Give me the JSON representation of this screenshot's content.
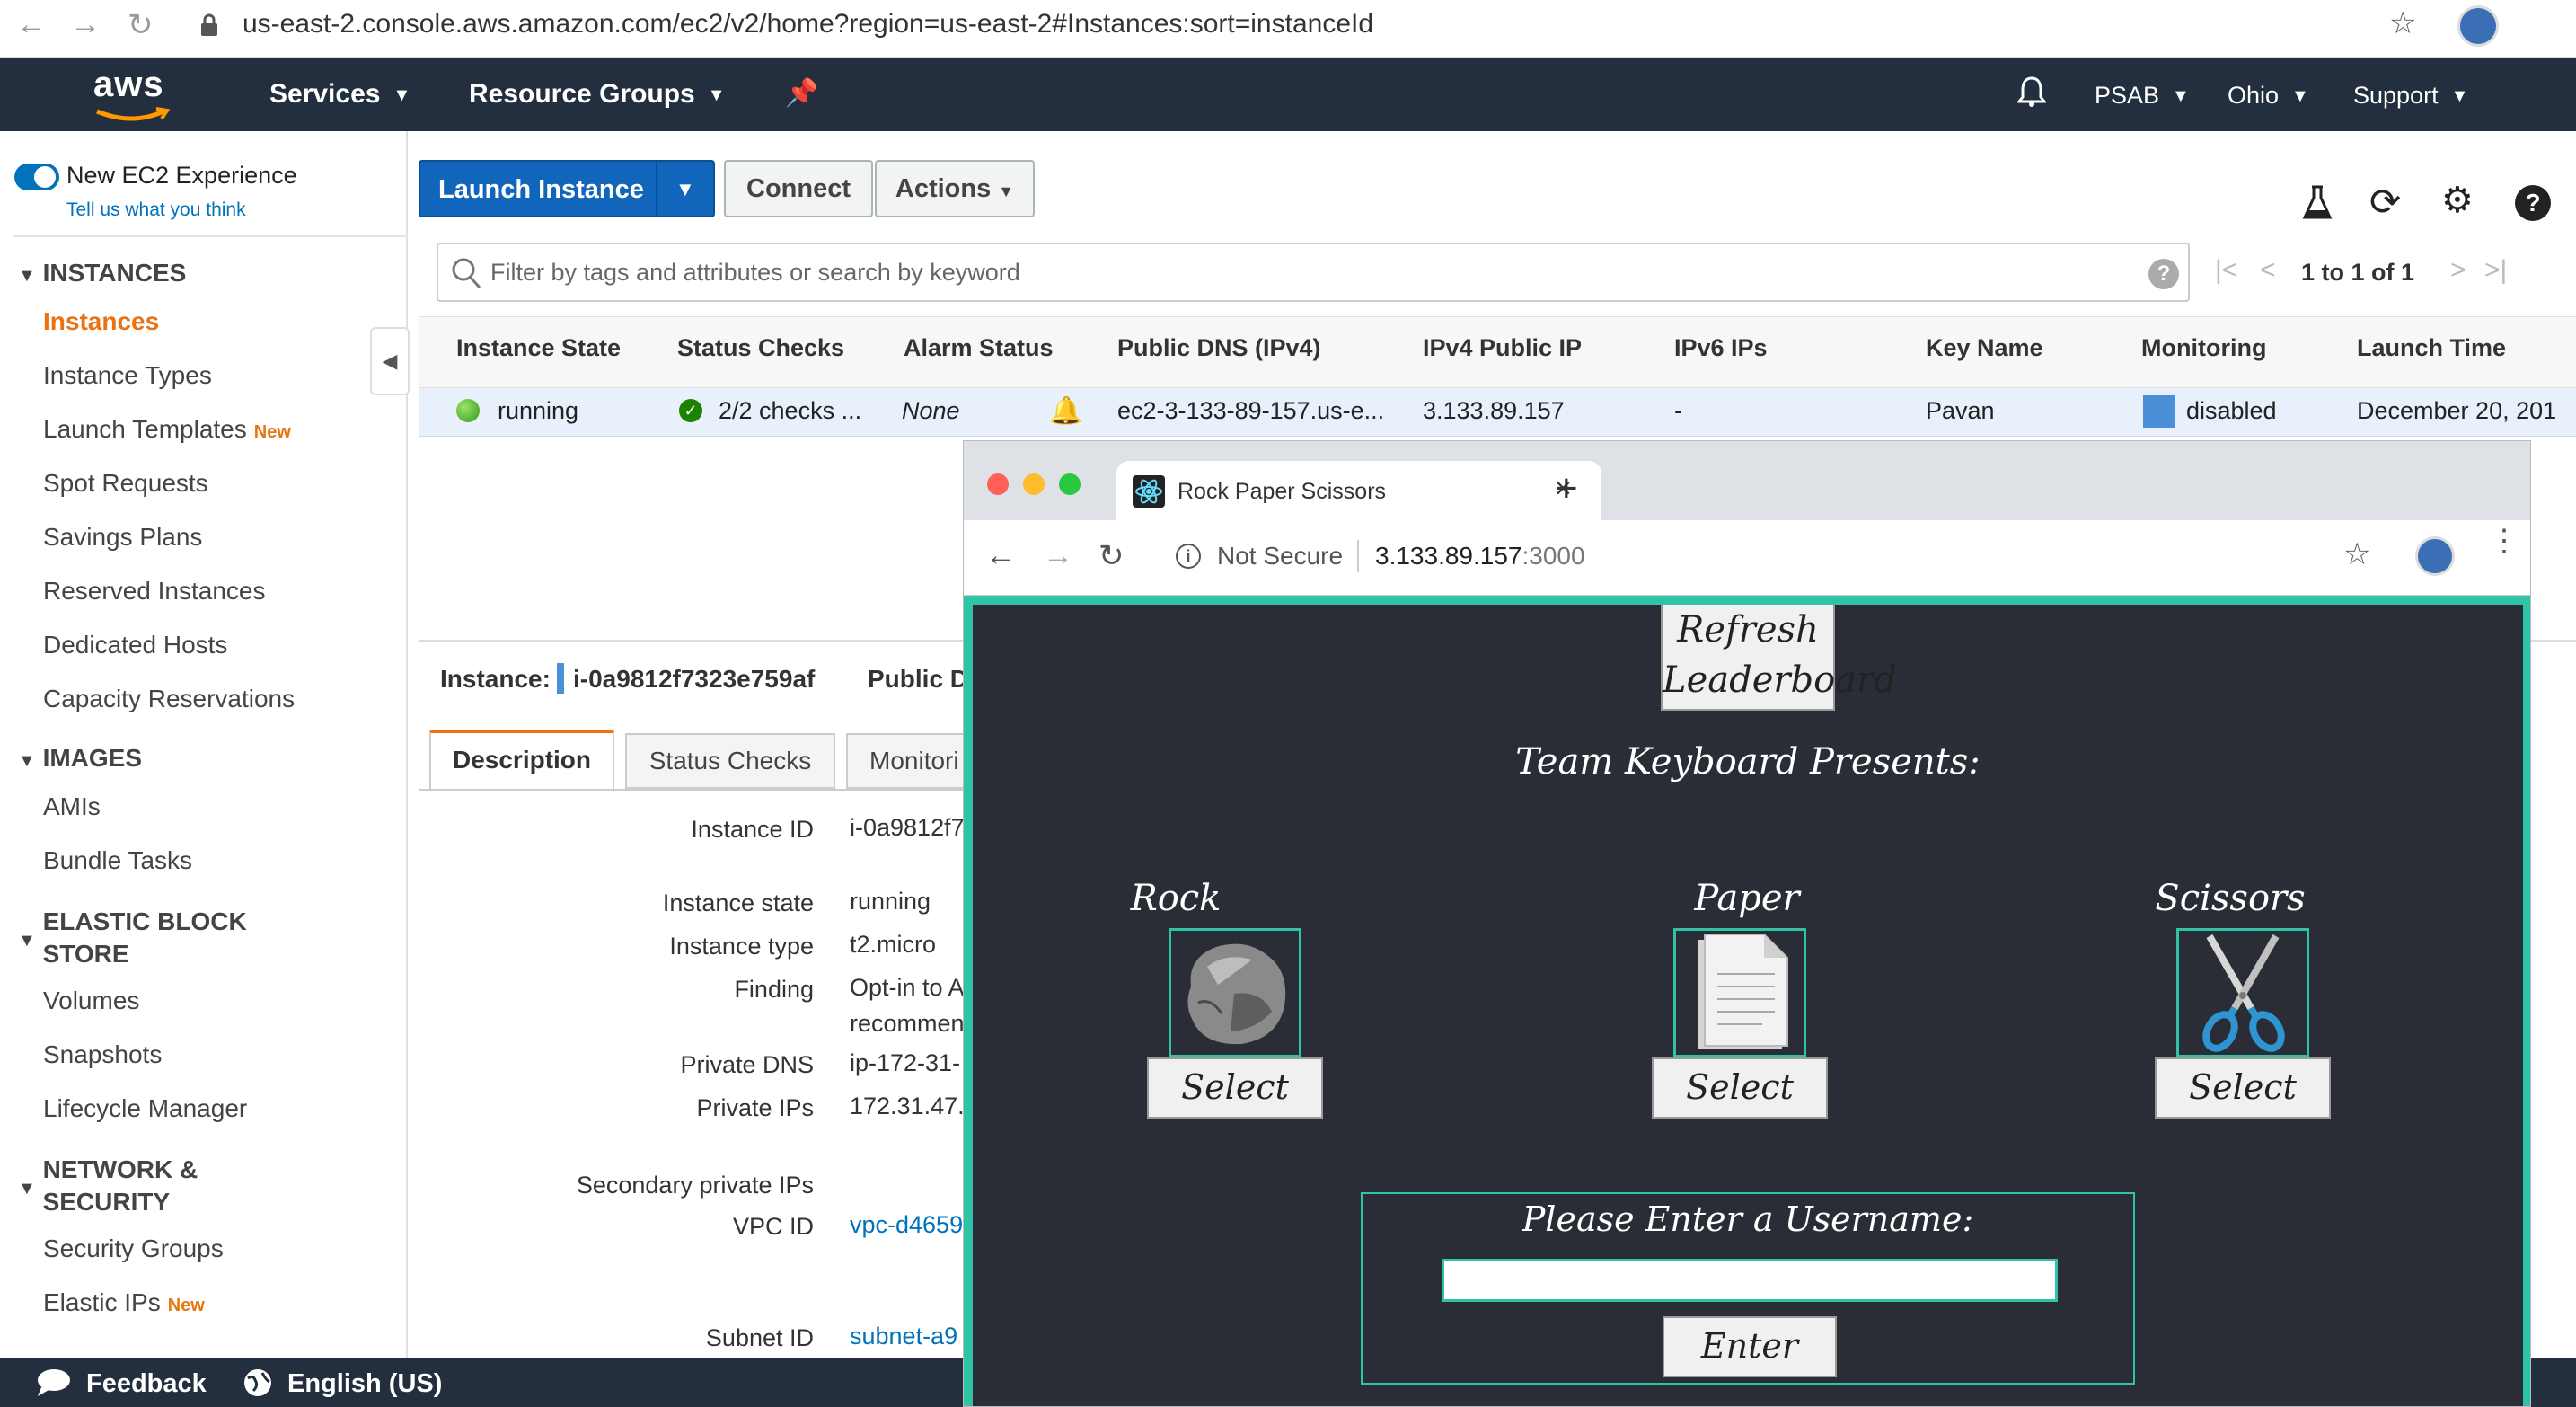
{
  "browser": {
    "url": "us-east-2.console.aws.amazon.com/ec2/v2/home?region=us-east-2#Instances:sort=instanceId"
  },
  "aws_nav": {
    "logo": "aws",
    "services": "Services",
    "resource_groups": "Resource Groups",
    "account": "PSAB",
    "region": "Ohio",
    "support": "Support"
  },
  "sidebar": {
    "toggle_label": "New EC2 Experience",
    "feedback_link": "Tell us what you think",
    "new_tag": "New",
    "sections": [
      {
        "title": "INSTANCES",
        "items": [
          "Instances",
          "Instance Types",
          "Launch Templates",
          "Spot Requests",
          "Savings Plans",
          "Reserved Instances",
          "Dedicated Hosts",
          "Capacity Reservations"
        ]
      },
      {
        "title": "IMAGES",
        "items": [
          "AMIs",
          "Bundle Tasks"
        ]
      },
      {
        "title_line1": "ELASTIC BLOCK",
        "title_line2": "STORE",
        "items": [
          "Volumes",
          "Snapshots",
          "Lifecycle Manager"
        ]
      },
      {
        "title_line1": "NETWORK &",
        "title_line2": "SECURITY",
        "items": [
          "Security Groups",
          "Elastic IPs"
        ]
      }
    ]
  },
  "toolbar": {
    "launch": "Launch Instance",
    "connect": "Connect",
    "actions": "Actions"
  },
  "filter": {
    "placeholder": "Filter by tags and attributes or search by keyword",
    "pagination": "1 to 1 of 1"
  },
  "table": {
    "headers": [
      "Instance State",
      "Status Checks",
      "Alarm Status",
      "Public DNS (IPv4)",
      "IPv4 Public IP",
      "IPv6 IPs",
      "Key Name",
      "Monitoring",
      "Launch Time"
    ],
    "row": {
      "state": "running",
      "checks": "2/2 checks ...",
      "alarm": "None",
      "dns": "ec2-3-133-89-157.us-e...",
      "ip": "3.133.89.157",
      "ipv6": "-",
      "key": "Pavan",
      "monitoring": "disabled",
      "launch": "December 20, 201"
    }
  },
  "details": {
    "instance_label": "Instance:",
    "instance_id": "i-0a9812f7323e759af",
    "public_label": "Public D",
    "tabs": [
      "Description",
      "Status Checks",
      "Monitori"
    ],
    "fields": [
      {
        "label": "Instance ID",
        "value": "i-0a9812f7"
      },
      {
        "label": "Instance state",
        "value": "running"
      },
      {
        "label": "Instance type",
        "value": "t2.micro"
      },
      {
        "label": "Finding",
        "value": "Opt-in to A"
      },
      {
        "label": "",
        "value": "recommen"
      },
      {
        "label": "Private DNS",
        "value": "ip-172-31-"
      },
      {
        "label": "Private IPs",
        "value": "172.31.47."
      },
      {
        "label": "Secondary private IPs",
        "value": ""
      },
      {
        "label": "VPC ID",
        "value": "vpc-d4659"
      },
      {
        "label": "Subnet ID",
        "value": "subnet-a9"
      }
    ]
  },
  "footer": {
    "feedback": "Feedback",
    "language": "English (US)"
  },
  "popup": {
    "tab_title": "Rock Paper Scissors",
    "not_secure": "Not Secure",
    "url_host": "3.133.89.157",
    "url_port": ":3000",
    "refresh_line1": "Refresh",
    "refresh_line2": "Leaderboard",
    "presents": "Team Keyboard Presents:",
    "choices": [
      {
        "name": "Rock",
        "button": "Select"
      },
      {
        "name": "Paper",
        "button": "Select"
      },
      {
        "name": "Scissors",
        "button": "Select"
      }
    ],
    "username_prompt": "Please Enter a Username:",
    "enter_button": "Enter"
  },
  "colors": {
    "aws_nav": "#232f3e",
    "aws_orange": "#ec7211",
    "launch_blue": "#1166bb",
    "teal": "#2ec4a5",
    "rps_bg": "#2a2d35"
  }
}
